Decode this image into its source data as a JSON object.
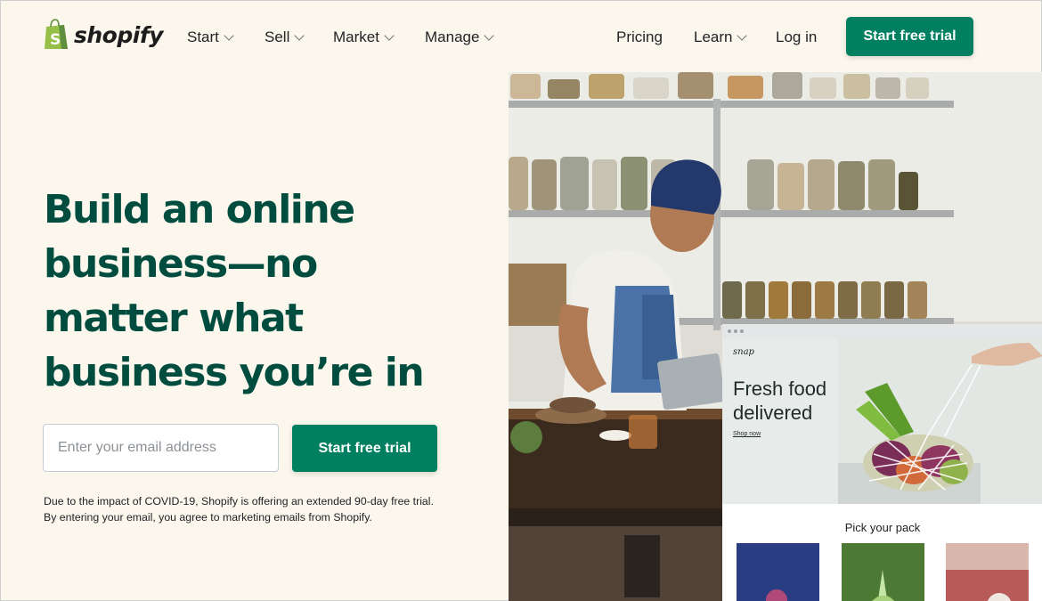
{
  "brand": {
    "name": "shopify",
    "primary_color": "#008060",
    "headline_color": "#004c3f",
    "background": "#fbf7ed",
    "logo_green": "#95bf47"
  },
  "nav": {
    "items": [
      {
        "label": "Start",
        "has_dropdown": true
      },
      {
        "label": "Sell",
        "has_dropdown": true
      },
      {
        "label": "Market",
        "has_dropdown": true
      },
      {
        "label": "Manage",
        "has_dropdown": true
      }
    ],
    "right": [
      {
        "label": "Pricing",
        "has_dropdown": false
      },
      {
        "label": "Learn",
        "has_dropdown": true
      },
      {
        "label": "Log in",
        "has_dropdown": false
      }
    ],
    "cta": "Start free trial"
  },
  "hero": {
    "title": "Build an online business—no matter what business you’re in",
    "email_placeholder": "Enter your email address",
    "cta": "Start free trial",
    "disclaimer_line1": "Due to the impact of COVID-19, Shopify is offering an extended 90-day free trial.",
    "disclaimer_line2": "By entering your email, you agree to marketing emails from Shopify."
  },
  "inset": {
    "logo": "snap",
    "title": "Fresh food delivered",
    "link": "Shop now",
    "pack_heading": "Pick your pack",
    "pack_colors": [
      "#2b3d82",
      "#4c7a34",
      "#b85a57"
    ]
  }
}
